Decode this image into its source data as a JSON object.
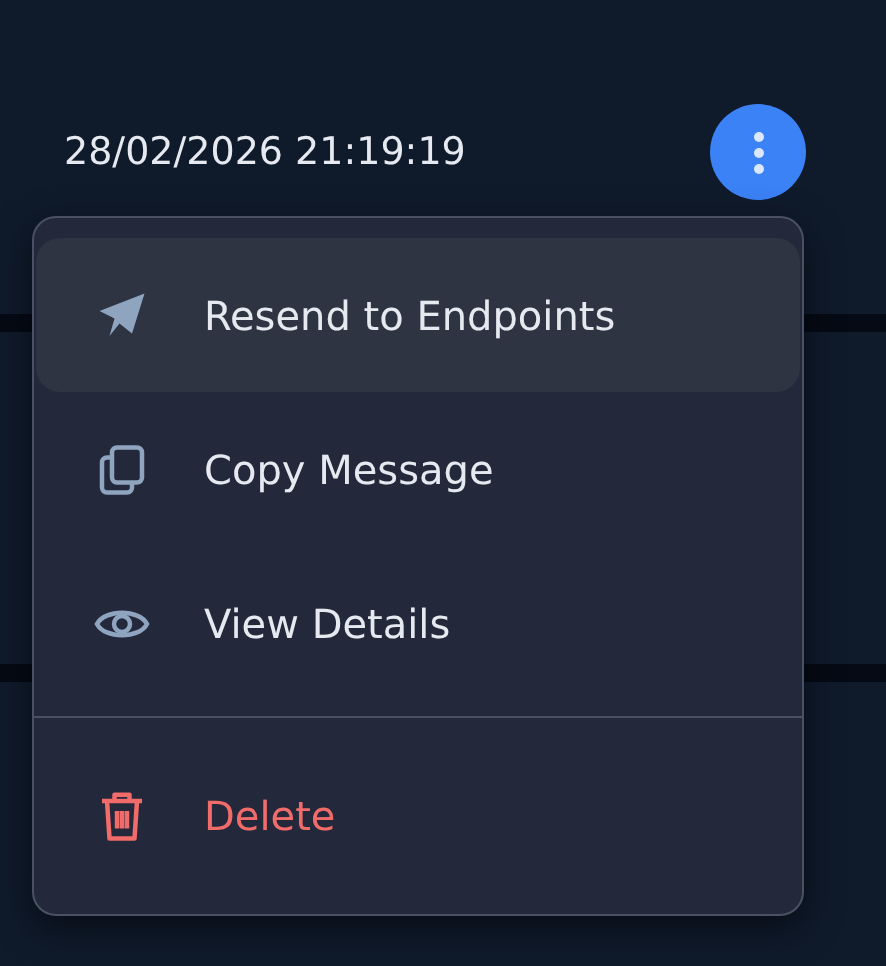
{
  "row": {
    "timestamp": "28/02/2026 21:19:19"
  },
  "menu": {
    "items": [
      {
        "label": "Resend to Endpoints",
        "kind": "action",
        "selected": true
      },
      {
        "label": "Copy Message",
        "kind": "action",
        "selected": false
      },
      {
        "label": "View Details",
        "kind": "action",
        "selected": false
      },
      {
        "label": "Delete",
        "kind": "danger",
        "selected": false
      }
    ]
  }
}
